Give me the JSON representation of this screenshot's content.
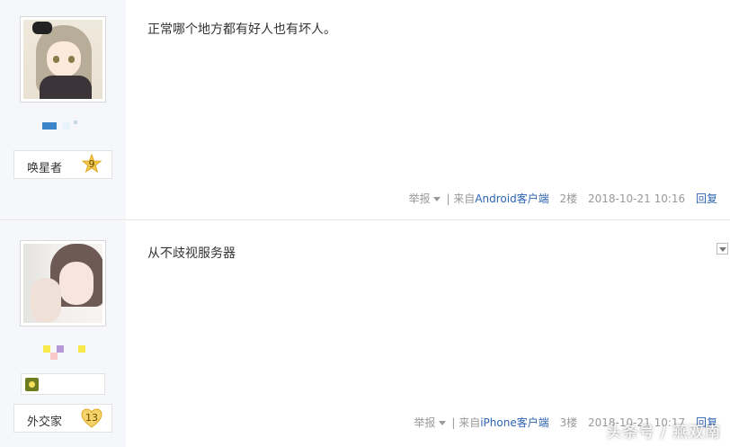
{
  "posts": [
    {
      "avatar_desc_icon": "anime-girl-avatar",
      "user_title": "唤星者",
      "level": "9",
      "badge_colors": [
        "#3a86c8",
        "#3a86c8",
        "#e8f4fb",
        "#e8f4fb"
      ],
      "content": "正常哪个地方都有好人也有坏人。",
      "report_label": "举报",
      "source_prefix": "| 来自",
      "source_client": "Android客户端",
      "floor": "2楼",
      "timestamp": "2018-10-21 10:16",
      "reply_label": "回复"
    },
    {
      "avatar_desc_icon": "photo-girl-avatar",
      "user_title": "外交家",
      "level": "13",
      "badge_colors": [
        "#f7e94a",
        "#b69ad8",
        "#f9c9c9",
        "#f7e94a"
      ],
      "content": "从不歧视服务器",
      "report_label": "举报",
      "source_prefix": "| 来自",
      "source_client": "iPhone客户端",
      "floor": "3楼",
      "timestamp": "2018-10-21 10:17",
      "reply_label": "回复"
    }
  ],
  "colors": {
    "sidebar_bg": "#f5f7fa",
    "link": "#2d64b3",
    "meta": "#999999",
    "level_star": "#f2c94c"
  },
  "watermark": "头条号 / 燕双南"
}
